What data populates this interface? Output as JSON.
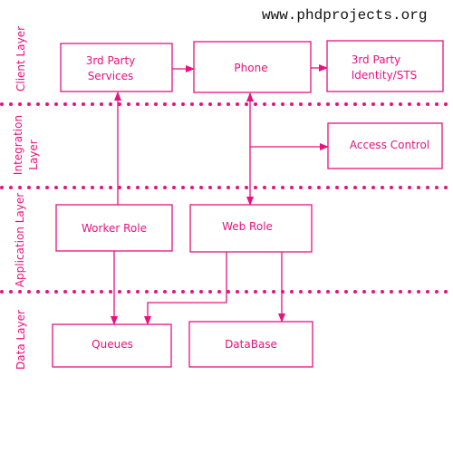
{
  "watermark": "www.phdprojects.org",
  "colors": {
    "accent": "#e8117f"
  },
  "layers": {
    "client": "Client Layer",
    "integration_line1": "Integration",
    "integration_line2": "Layer",
    "application": "Application Layer",
    "data": "Data Layer"
  },
  "nodes": {
    "third_party_services": {
      "line1": "3rd Party",
      "line2": "Services"
    },
    "phone": "Phone",
    "third_party_identity": {
      "line1": "3rd Party",
      "line2": "Identity/STS"
    },
    "access_control": "Access Control",
    "worker_role": "Worker Role",
    "web_role": "Web Role",
    "queues": "Queues",
    "database": "DataBase"
  },
  "edges": [
    {
      "from": "3rd Party Services",
      "to": "Phone"
    },
    {
      "from": "Phone",
      "to": "3rd Party Identity/STS"
    },
    {
      "from": "Worker Role",
      "to": "3rd Party Services"
    },
    {
      "from": "Phone",
      "to": "Web Role",
      "bidirectional": true
    },
    {
      "from": "Phone",
      "to": "Access Control"
    },
    {
      "from": "Worker Role",
      "to": "Queues"
    },
    {
      "from": "Web Role",
      "to": "Queues"
    },
    {
      "from": "Web Role",
      "to": "DataBase"
    }
  ]
}
